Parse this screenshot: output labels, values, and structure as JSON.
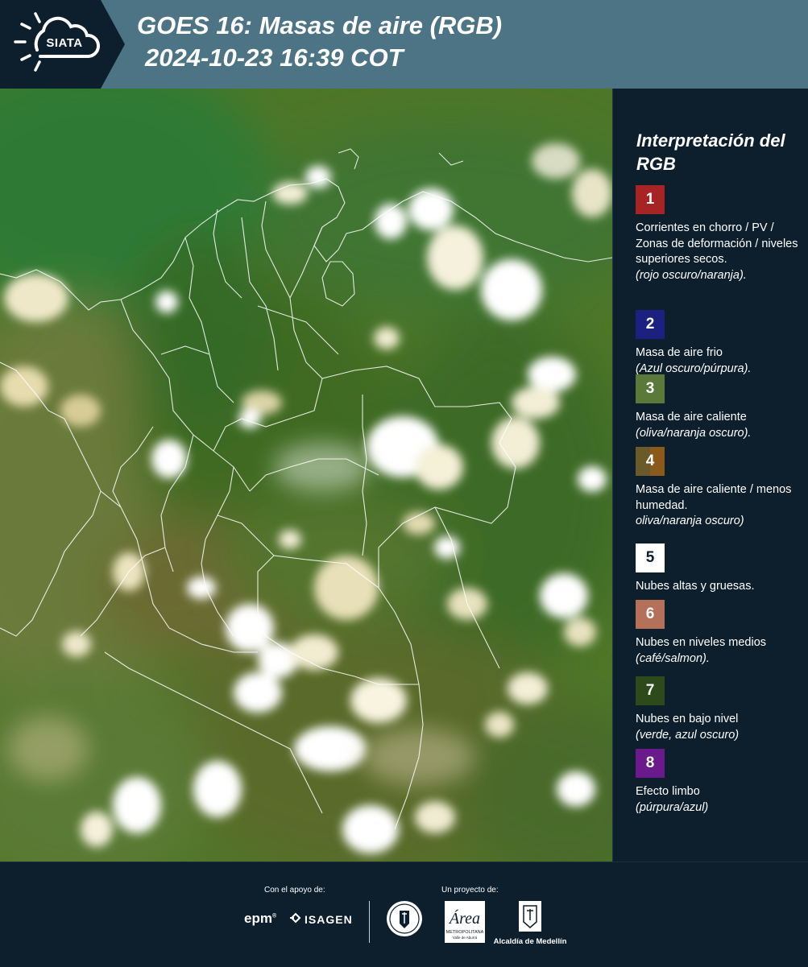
{
  "header": {
    "logo_text": "SIATA",
    "title_line_1": "GOES 16: Masas de aire (RGB)",
    "title_line_2": "2024-10-23 16:39 COT"
  },
  "colors": {
    "header_bg": "#4c7484",
    "panel_bg": "#0d1f2d",
    "map_base": "#4e7628"
  },
  "legend": {
    "title": "Interpretación del RGB",
    "items": [
      {
        "number": "1",
        "description": "Corrientes en chorro / PV / Zonas de deformación / niveles superiores secos.",
        "note": "(rojo oscuro/naranja).",
        "color": "#a82424"
      },
      {
        "number": "2",
        "description": "Masa de aire frio",
        "note": "(Azul oscuro/púrpura).",
        "color": "#1c2080"
      },
      {
        "number": "3",
        "description": "Masa de aire caliente",
        "note": "(oliva/naranja oscuro).",
        "color": "#5a7a3a"
      },
      {
        "number": "4",
        "description": "Masa de aire caliente / menos humedad.",
        "note": "oliva/naranja oscuro)",
        "color": "#6a5a2a",
        "color_alt": "#8a5a1a"
      },
      {
        "number": "5",
        "description": "Nubes altas y gruesas.",
        "note": "",
        "color": "#ffffff"
      },
      {
        "number": "6",
        "description": "Nubes en niveles medios",
        "note": "(café/salmon).",
        "color": "#b5705a"
      },
      {
        "number": "7",
        "description": "Nubes en bajo nivel",
        "note": "(verde, azul oscuro)",
        "color": "#2c4a1a"
      },
      {
        "number": "8",
        "description": "Efecto limbo",
        "note": "(púrpura/azul)",
        "color": "#6a1a8a"
      }
    ]
  },
  "footer": {
    "support_label": "Con el apoyo de:",
    "project_label": "Un proyecto de:",
    "epm": "epm",
    "isagen": "ISAGEN",
    "alcaldia": "Alcaldía de Medellín",
    "area_metropolitana": "Área",
    "area_sub": "METROPOLITANA",
    "area_sub2": "Valle de Aburrá"
  }
}
